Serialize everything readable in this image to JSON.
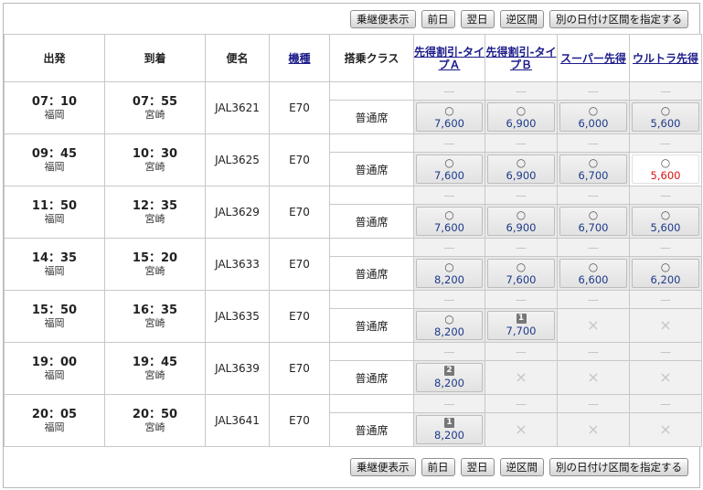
{
  "toolbar": {
    "connecting": "乗継便表示",
    "prev_day": "前日",
    "next_day": "翌日",
    "reverse": "逆区間",
    "other_date": "別の日付け区間を指定する"
  },
  "headers": {
    "depart": "出発",
    "arrive": "到着",
    "flight": "便名",
    "aircraft": "機種",
    "cabin": "搭乗クラス",
    "fare_a": "先得割引-タイプＡ",
    "fare_b": "先得割引-タイプＢ",
    "super": "スーパー先得",
    "ultra": "ウルトラ先得"
  },
  "flights": [
    {
      "dep": "07：10",
      "dep_apt": "福岡",
      "arr": "07：55",
      "arr_apt": "宮崎",
      "flight": "JAL3621",
      "type": "E70",
      "cabin": "普通席",
      "fares": [
        {
          "mark": "○",
          "price": "7,600"
        },
        {
          "mark": "○",
          "price": "6,900"
        },
        {
          "mark": "○",
          "price": "6,000"
        },
        {
          "mark": "○",
          "price": "5,600"
        }
      ]
    },
    {
      "dep": "09：45",
      "dep_apt": "福岡",
      "arr": "10：30",
      "arr_apt": "宮崎",
      "flight": "JAL3625",
      "type": "E70",
      "cabin": "普通席",
      "fares": [
        {
          "mark": "○",
          "price": "7,600"
        },
        {
          "mark": "○",
          "price": "6,900"
        },
        {
          "mark": "○",
          "price": "6,700"
        },
        {
          "mark": "○",
          "price": "5,600",
          "selected": true
        }
      ]
    },
    {
      "dep": "11：50",
      "dep_apt": "福岡",
      "arr": "12：35",
      "arr_apt": "宮崎",
      "flight": "JAL3629",
      "type": "E70",
      "cabin": "普通席",
      "fares": [
        {
          "mark": "○",
          "price": "7,600"
        },
        {
          "mark": "○",
          "price": "6,900"
        },
        {
          "mark": "○",
          "price": "6,700"
        },
        {
          "mark": "○",
          "price": "5,600"
        }
      ]
    },
    {
      "dep": "14：35",
      "dep_apt": "福岡",
      "arr": "15：20",
      "arr_apt": "宮崎",
      "flight": "JAL3633",
      "type": "E70",
      "cabin": "普通席",
      "fares": [
        {
          "mark": "○",
          "price": "8,200"
        },
        {
          "mark": "○",
          "price": "7,600"
        },
        {
          "mark": "○",
          "price": "6,600"
        },
        {
          "mark": "○",
          "price": "6,200"
        }
      ]
    },
    {
      "dep": "15：50",
      "dep_apt": "福岡",
      "arr": "16：35",
      "arr_apt": "宮崎",
      "flight": "JAL3635",
      "type": "E70",
      "cabin": "普通席",
      "fares": [
        {
          "mark": "○",
          "price": "8,200"
        },
        {
          "num": "1",
          "price": "7,700"
        },
        {
          "cross": "×"
        },
        {
          "cross": "×"
        }
      ]
    },
    {
      "dep": "19：00",
      "dep_apt": "福岡",
      "arr": "19：45",
      "arr_apt": "宮崎",
      "flight": "JAL3639",
      "type": "E70",
      "cabin": "普通席",
      "fares": [
        {
          "num": "2",
          "price": "8,200"
        },
        {
          "cross": "×"
        },
        {
          "cross": "×"
        },
        {
          "cross": "×"
        }
      ]
    },
    {
      "dep": "20：05",
      "dep_apt": "福岡",
      "arr": "20：50",
      "arr_apt": "宮崎",
      "flight": "JAL3641",
      "type": "E70",
      "cabin": "普通席",
      "fares": [
        {
          "num": "1",
          "price": "8,200"
        },
        {
          "cross": "×"
        },
        {
          "cross": "×"
        },
        {
          "cross": "×"
        }
      ]
    }
  ],
  "dash": "—"
}
